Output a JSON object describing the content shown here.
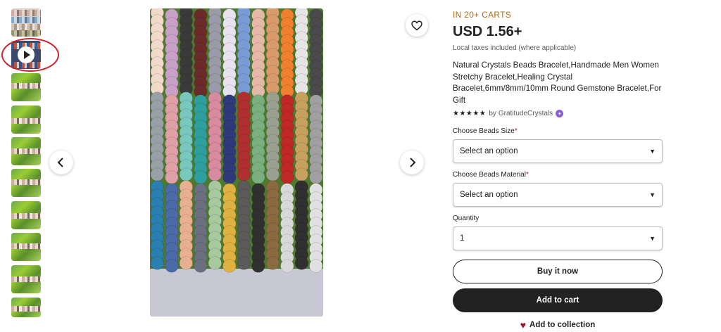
{
  "thumbnails": [
    {
      "type": "image",
      "colors": [
        "#c9a79a",
        "#7fa6c9",
        "#d4c3b8",
        "#8c8f6b"
      ]
    },
    {
      "type": "video"
    },
    {
      "type": "image",
      "colors": [
        "#6aa84f"
      ]
    },
    {
      "type": "image",
      "colors": [
        "#6aa84f"
      ]
    },
    {
      "type": "image",
      "colors": [
        "#6aa84f"
      ]
    },
    {
      "type": "image",
      "colors": [
        "#6aa84f"
      ]
    },
    {
      "type": "image",
      "colors": [
        "#6aa84f"
      ]
    },
    {
      "type": "image",
      "colors": [
        "#6aa84f"
      ]
    },
    {
      "type": "image",
      "colors": [
        "#6aa84f"
      ]
    },
    {
      "type": "image",
      "colors": [
        "#6aa84f"
      ]
    }
  ],
  "gallery": {
    "prev_icon": "chevron-left-icon",
    "next_icon": "chevron-right-icon",
    "favorite_icon": "heart-outline-icon"
  },
  "product": {
    "demand_badge": "IN 20+ CARTS",
    "price": "USD 1.56+",
    "tax_note": "Local taxes included (where applicable)",
    "title": "Natural Crystals Beads Bracelet,Handmade Men Women Stretchy Bracelet,Healing Crystal Bracelet,6mm/8mm/10mm Round Gemstone Bracelet,For Gift",
    "rating_stars": "★★★★★",
    "seller_prefix": "by",
    "seller": "GratitudeCrystals"
  },
  "options": {
    "size_label": "Choose Beads Size",
    "size_value": "Select an option",
    "material_label": "Choose Beads Material",
    "material_value": "Select an option",
    "required_mark": "*",
    "quantity_label": "Quantity",
    "quantity_value": "1"
  },
  "actions": {
    "buy_now": "Buy it now",
    "add_to_cart": "Add to cart",
    "add_to_collection": "Add to collection"
  },
  "colors": {
    "accent_badge": "#a96d1d",
    "button_dark": "#222222",
    "annotation_circle": "#d0202a"
  }
}
